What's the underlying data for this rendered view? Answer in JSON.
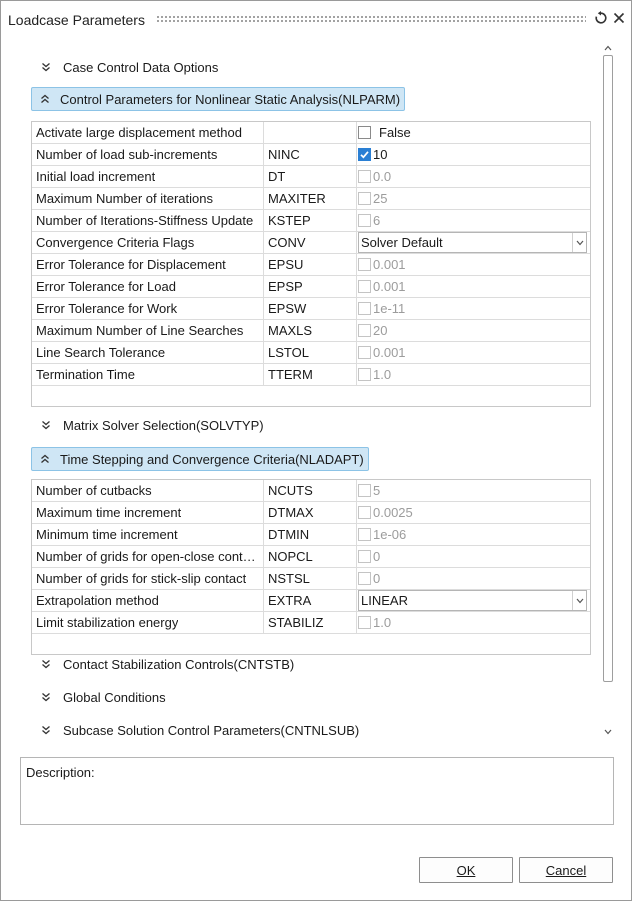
{
  "window": {
    "title": "Loadcase Parameters",
    "reset_icon": "reset-icon",
    "close_icon": "close-icon"
  },
  "sections": {
    "case_control": {
      "label": "Case Control Data Options",
      "expanded": false
    },
    "nlparm": {
      "label": "Control Parameters for Nonlinear Static Analysis(NLPARM)",
      "expanded": true,
      "rows": [
        {
          "name": "Activate large displacement method",
          "key": "",
          "value": "False",
          "checked": false,
          "disabled": false,
          "control": "checkbox"
        },
        {
          "name": "Number of load sub-increments",
          "key": "NINC",
          "value": "10",
          "checked": true,
          "disabled": false,
          "control": "checkbox"
        },
        {
          "name": "Initial load increment",
          "key": "DT",
          "value": "0.0",
          "checked": false,
          "disabled": true,
          "control": "checkbox"
        },
        {
          "name": "Maximum Number of iterations",
          "key": "MAXITER",
          "value": "25",
          "checked": false,
          "disabled": true,
          "control": "checkbox"
        },
        {
          "name": "Number of Iterations-Stiffness Update",
          "key": "KSTEP",
          "value": "6",
          "checked": false,
          "disabled": true,
          "control": "checkbox"
        },
        {
          "name": "Convergence Criteria Flags",
          "key": "CONV",
          "value": "Solver Default",
          "control": "combo"
        },
        {
          "name": "Error Tolerance for Displacement",
          "key": "EPSU",
          "value": "0.001",
          "checked": false,
          "disabled": true,
          "control": "checkbox"
        },
        {
          "name": "Error Tolerance for Load",
          "key": "EPSP",
          "value": "0.001",
          "checked": false,
          "disabled": true,
          "control": "checkbox"
        },
        {
          "name": "Error Tolerance for Work",
          "key": "EPSW",
          "value": "1e-11",
          "checked": false,
          "disabled": true,
          "control": "checkbox"
        },
        {
          "name": "Maximum Number of Line Searches",
          "key": "MAXLS",
          "value": "20",
          "checked": false,
          "disabled": true,
          "control": "checkbox"
        },
        {
          "name": "Line Search Tolerance",
          "key": "LSTOL",
          "value": "0.001",
          "checked": false,
          "disabled": true,
          "control": "checkbox"
        },
        {
          "name": "Termination Time",
          "key": "TTERM",
          "value": "1.0",
          "checked": false,
          "disabled": true,
          "control": "checkbox"
        }
      ]
    },
    "solvtyp": {
      "label": "Matrix Solver Selection(SOLVTYP)",
      "expanded": false
    },
    "nladapt": {
      "label": "Time Stepping and Convergence Criteria(NLADAPT)",
      "expanded": true,
      "rows": [
        {
          "name": "Number of cutbacks",
          "key": "NCUTS",
          "value": "5",
          "checked": false,
          "disabled": true,
          "control": "checkbox"
        },
        {
          "name": "Maximum time increment",
          "key": "DTMAX",
          "value": "0.0025",
          "checked": false,
          "disabled": true,
          "control": "checkbox"
        },
        {
          "name": "Minimum time increment",
          "key": "DTMIN",
          "value": "1e-06",
          "checked": false,
          "disabled": true,
          "control": "checkbox"
        },
        {
          "name": "Number of grids for open-close cont…",
          "key": "NOPCL",
          "value": "0",
          "checked": false,
          "disabled": true,
          "control": "checkbox"
        },
        {
          "name": "Number of grids for stick-slip contact",
          "key": "NSTSL",
          "value": "0",
          "checked": false,
          "disabled": true,
          "control": "checkbox"
        },
        {
          "name": "Extrapolation method",
          "key": "EXTRA",
          "value": "LINEAR",
          "control": "combo"
        },
        {
          "name": "Limit stabilization energy",
          "key": "STABILIZ",
          "value": "1.0",
          "checked": false,
          "disabled": true,
          "control": "checkbox"
        }
      ]
    },
    "cntstb": {
      "label": "Contact Stabilization Controls(CNTSTB)",
      "expanded": false
    },
    "global": {
      "label": "Global Conditions",
      "expanded": false
    },
    "cntnlsub": {
      "label": "Subcase Solution Control Parameters(CNTNLSUB)",
      "expanded": false
    }
  },
  "description": {
    "label": "Description:",
    "value": ""
  },
  "buttons": {
    "ok": "OK",
    "cancel": "Cancel"
  },
  "colors": {
    "expanded_header_bg": "#cfe6f5",
    "expanded_header_border": "#8cc3e6",
    "checkbox_checked": "#2a7fd4",
    "disabled_text": "#9c9c9c"
  }
}
